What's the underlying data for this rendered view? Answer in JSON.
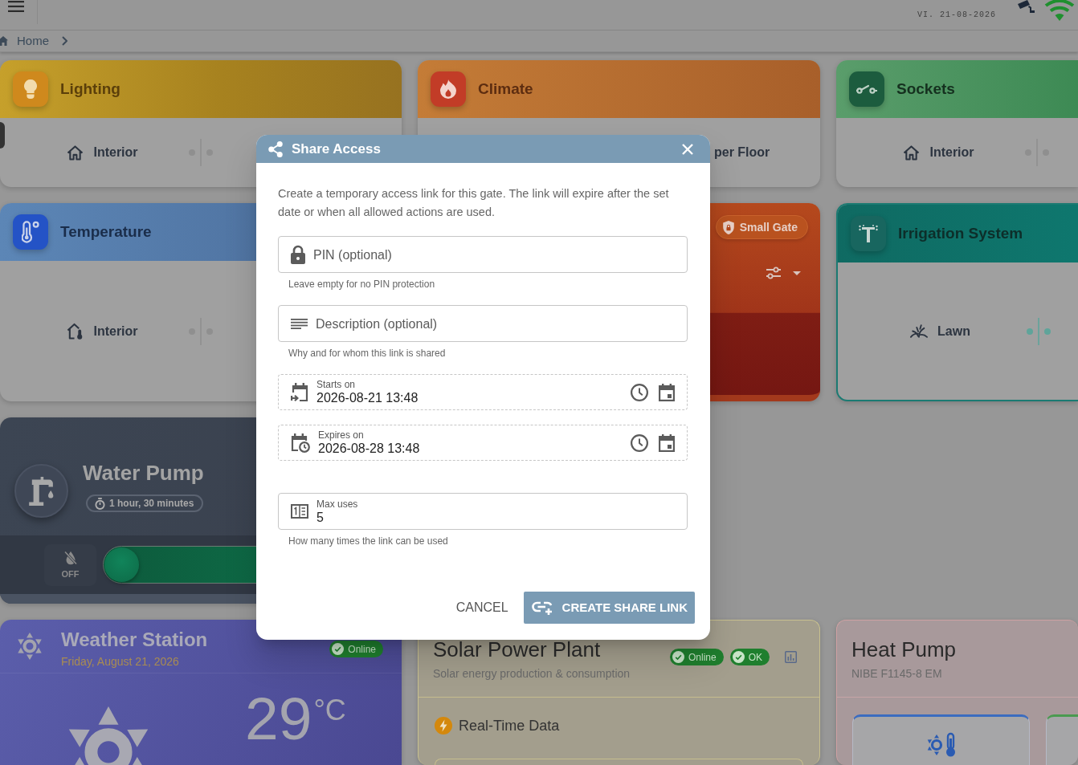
{
  "top_bar": {
    "date": "VI. 21-08-2026"
  },
  "breadcrumb": [
    {
      "label": "Home"
    }
  ],
  "rows": [
    [
      {
        "kind": "lighting",
        "title": "Lighting",
        "items": [
          {
            "label": "Interior",
            "on": false
          }
        ]
      },
      {
        "kind": "climate",
        "title": "Climate",
        "items": [
          {
            "label": "per Floor"
          }
        ]
      },
      {
        "kind": "sockets",
        "title": "Sockets",
        "items": [
          {
            "label": "Interior",
            "on": false
          }
        ]
      }
    ],
    [
      {
        "kind": "temperature",
        "title": "Temperature",
        "items": [
          {
            "label": "Interior",
            "on": false
          }
        ]
      },
      {
        "kind": "gate",
        "title": "Small Gate"
      },
      {
        "kind": "irrigation",
        "title": "Irrigation System",
        "items": [
          {
            "label": "Lawn",
            "on": false
          }
        ]
      }
    ],
    [
      {
        "kind": "pump",
        "title": "Water Pump",
        "timer": "1 hour, 30 minutes",
        "button": "OFF",
        "level": 0
      }
    ],
    [
      {
        "kind": "weather",
        "title": "Weather Station",
        "date": "Friday, August 21, 2026",
        "status": "Online",
        "temperature": "29$^{°C}$"
      },
      {
        "kind": "solar",
        "title": "Solar Power Plant",
        "subtitle": "Solar energy production & consumption",
        "badges": [
          "Online",
          "OK"
        ],
        "section": "Real-Time Data"
      },
      {
        "kind": "heat_pump",
        "title": "Heat Pump",
        "subtitle": "NIBE F1145-8 EM"
      }
    ]
  ],
  "dialog": {
    "title": "Share Access",
    "intro": "Create a temporary access link for this gate. The link will expire after the set date or when all allowed actions are used.",
    "fields": [
      {
        "kind": "pin",
        "placeholder": "PIN (optional)",
        "helper": "Leave empty for no PIN protection"
      },
      {
        "kind": "note",
        "placeholder": "Description (optional)",
        "helper": "Why and for whom this link is shared"
      },
      {
        "kind": "start",
        "label": "Starts on",
        "value": "2026-08-21 13:48"
      },
      {
        "kind": "expiry",
        "label": "Expires on",
        "value": "2026-08-28 13:48"
      },
      {
        "kind": "number",
        "label": "Max uses",
        "value": "5",
        "helper": "How many times the link can be used"
      }
    ],
    "buttons": [
      {
        "kind": "text",
        "label": "CANCEL"
      },
      {
        "kind": "primary",
        "label": "CREATE SHARE LINK"
      }
    ]
  }
}
